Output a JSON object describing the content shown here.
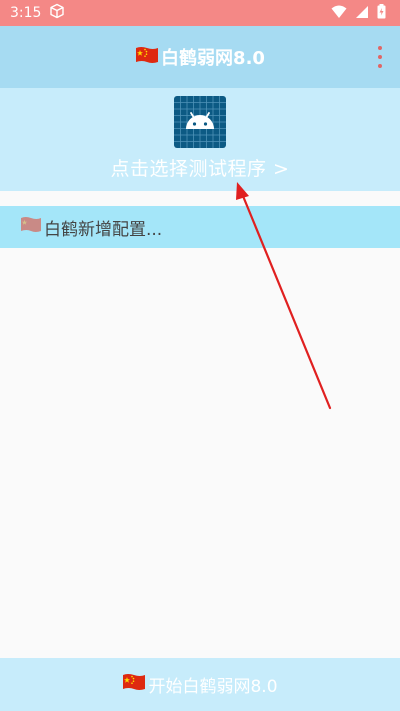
{
  "status_bar": {
    "time": "3:15",
    "icons": [
      "cube-icon",
      "wifi-icon",
      "signal-icon",
      "battery-icon"
    ]
  },
  "app_bar": {
    "title": "白鹤弱网8.0",
    "flag_icon": "china-flag-icon",
    "menu_icon": "more-vert-icon"
  },
  "header": {
    "app_icon": "android-icon",
    "select_label": "点击选择测试程序 >"
  },
  "config": {
    "label": "白鹤新增配置..."
  },
  "bottom": {
    "start_label": "开始白鹤弱网8.0"
  },
  "colors": {
    "status_bar": "#f48886",
    "app_bar": "#a6dbf2",
    "panel": "#c7ecfb",
    "config_bar": "#a4e6f9",
    "accent_red": "#e02020",
    "android_tile": "#0c5a84"
  }
}
